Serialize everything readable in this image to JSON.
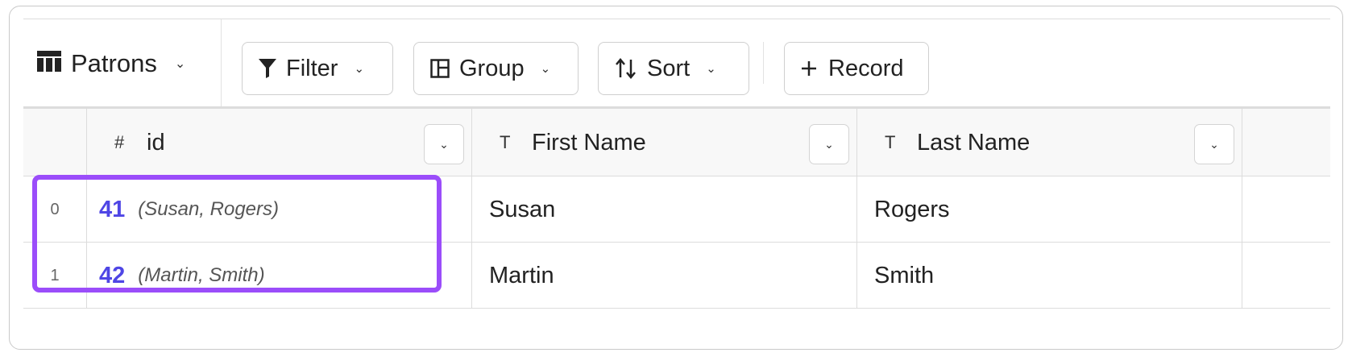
{
  "toolbar": {
    "table_name": "Patrons",
    "filter_label": "Filter",
    "group_label": "Group",
    "sort_label": "Sort",
    "record_label": "Record"
  },
  "columns": [
    {
      "type_icon": "#",
      "label": "id"
    },
    {
      "type_icon": "T",
      "label": "First Name"
    },
    {
      "type_icon": "T",
      "label": "Last Name"
    }
  ],
  "rows": [
    {
      "index": "0",
      "id": "41",
      "summary": "(Susan, Rogers)",
      "first_name": "Susan",
      "last_name": "Rogers"
    },
    {
      "index": "1",
      "id": "42",
      "summary": "(Martin, Smith)",
      "first_name": "Martin",
      "last_name": "Smith"
    }
  ],
  "colors": {
    "link": "#4f46e5",
    "highlight": "#9b4dfa"
  }
}
